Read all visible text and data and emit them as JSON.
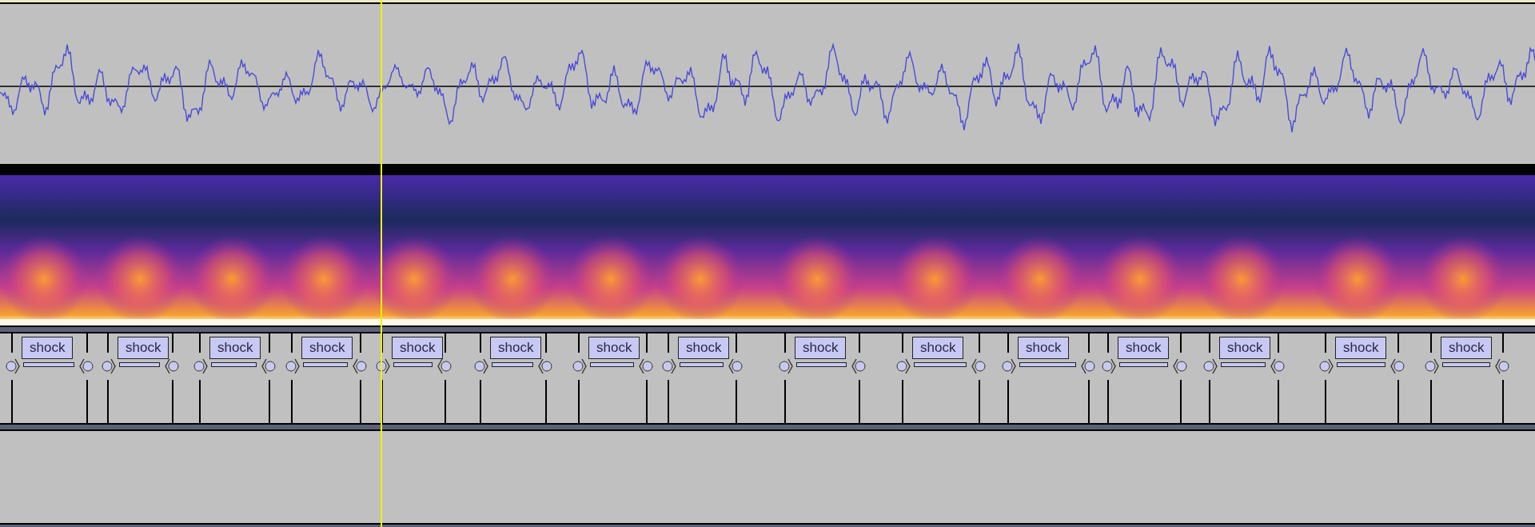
{
  "tracks": [
    {
      "kind": "waveform"
    },
    {
      "kind": "spectrogram"
    },
    {
      "kind": "labels",
      "labels": [
        {
          "text": "shock"
        },
        {
          "text": "shock"
        },
        {
          "text": "shock"
        },
        {
          "text": "shock"
        },
        {
          "text": "shock"
        },
        {
          "text": "shock"
        },
        {
          "text": "shock"
        },
        {
          "text": "shock"
        },
        {
          "text": "shock"
        },
        {
          "text": "shock"
        },
        {
          "text": "shock"
        },
        {
          "text": "shock"
        },
        {
          "text": "shock"
        },
        {
          "text": "shock"
        },
        {
          "text": "shock"
        }
      ]
    },
    {
      "kind": "empty"
    }
  ]
}
